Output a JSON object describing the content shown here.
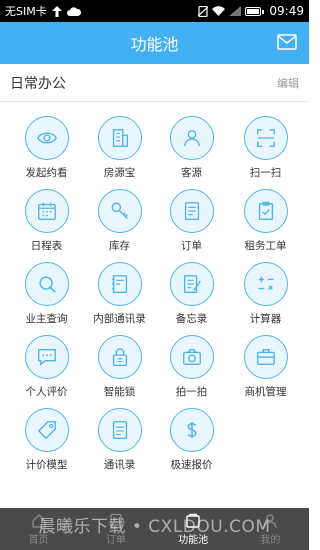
{
  "status": {
    "carrier": "无SIM卡",
    "time": "09:49"
  },
  "header": {
    "title": "功能池"
  },
  "section": {
    "name": "日常办公",
    "edit_label": "编辑"
  },
  "apps": [
    {
      "label": "发起约看",
      "icon": "eye-icon"
    },
    {
      "label": "房源宝",
      "icon": "building-icon"
    },
    {
      "label": "客源",
      "icon": "person-icon"
    },
    {
      "label": "扫一扫",
      "icon": "scan-icon"
    },
    {
      "label": "日程表",
      "icon": "calendar-icon"
    },
    {
      "label": "库存",
      "icon": "key-icon"
    },
    {
      "label": "订单",
      "icon": "list-icon"
    },
    {
      "label": "租务工单",
      "icon": "clipboard-check-icon"
    },
    {
      "label": "业主查询",
      "icon": "search-icon"
    },
    {
      "label": "内部通讯录",
      "icon": "contacts-book-icon"
    },
    {
      "label": "备忘录",
      "icon": "note-pencil-icon"
    },
    {
      "label": "计算器",
      "icon": "calculator-icon"
    },
    {
      "label": "个人评价",
      "icon": "comment-icon"
    },
    {
      "label": "智能锁",
      "icon": "lock-icon"
    },
    {
      "label": "拍一拍",
      "icon": "camera-icon"
    },
    {
      "label": "商机管理",
      "icon": "briefcase-icon"
    },
    {
      "label": "计价模型",
      "icon": "tag-icon"
    },
    {
      "label": "通讯录",
      "icon": "address-book-icon"
    },
    {
      "label": "极速报价",
      "icon": "dollar-icon"
    }
  ],
  "tabs": [
    {
      "label": "首页",
      "icon": "home-icon",
      "active": false
    },
    {
      "label": "订单",
      "icon": "order-icon",
      "active": false
    },
    {
      "label": "功能池",
      "icon": "pool-icon",
      "active": true
    },
    {
      "label": "我的",
      "icon": "profile-icon",
      "active": false
    }
  ],
  "watermark": "晨曦乐下载 • CXLDOU.COM",
  "colors": {
    "accent": "#42b0f2",
    "icon_stroke": "#4fb4ee",
    "icon_bg": "#eaf6fd",
    "bottom_bar": "#4a4a4a"
  }
}
